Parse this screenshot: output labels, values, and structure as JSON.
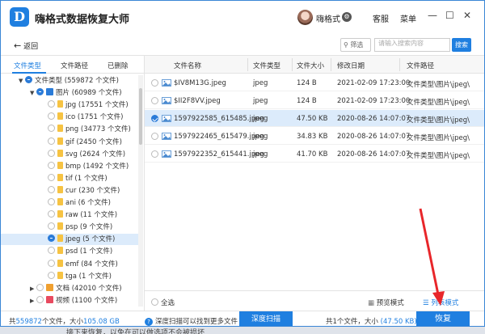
{
  "app": {
    "title": "嗨格式数据恢复大师",
    "logo_letter": "D",
    "username": "嗨格式",
    "service": "客服",
    "menu": "菜单"
  },
  "toolbar": {
    "back": "返回",
    "filter": "筛选",
    "search_placeholder": "请输入搜索内容",
    "search_btn": "搜索"
  },
  "left_tabs": [
    "文件类型",
    "文件路径",
    "已删除"
  ],
  "tree": [
    {
      "label": "文件类型 (559872 个文件)",
      "indent": 0,
      "arrow": "▼",
      "check": "part",
      "folder": "none"
    },
    {
      "label": "图片 (60989 个文件)",
      "indent": 1,
      "arrow": "▼",
      "check": "part",
      "folder": "pic"
    },
    {
      "label": "jpg (17551 个文件)",
      "indent": 2,
      "arrow": "",
      "check": "",
      "folder": "y"
    },
    {
      "label": "ico (1751 个文件)",
      "indent": 2,
      "arrow": "",
      "check": "",
      "folder": "y"
    },
    {
      "label": "png (34773 个文件)",
      "indent": 2,
      "arrow": "",
      "check": "",
      "folder": "y"
    },
    {
      "label": "gif (2450 个文件)",
      "indent": 2,
      "arrow": "",
      "check": "",
      "folder": "y"
    },
    {
      "label": "svg (2624 个文件)",
      "indent": 2,
      "arrow": "",
      "check": "",
      "folder": "y"
    },
    {
      "label": "bmp (1492 个文件)",
      "indent": 2,
      "arrow": "",
      "check": "",
      "folder": "y"
    },
    {
      "label": "tif (1 个文件)",
      "indent": 2,
      "arrow": "",
      "check": "",
      "folder": "y"
    },
    {
      "label": "cur (230 个文件)",
      "indent": 2,
      "arrow": "",
      "check": "",
      "folder": "y"
    },
    {
      "label": "ani (6 个文件)",
      "indent": 2,
      "arrow": "",
      "check": "",
      "folder": "y"
    },
    {
      "label": "raw (11 个文件)",
      "indent": 2,
      "arrow": "",
      "check": "",
      "folder": "y"
    },
    {
      "label": "psp (9 个文件)",
      "indent": 2,
      "arrow": "",
      "check": "",
      "folder": "y"
    },
    {
      "label": "jpeg (5 个文件)",
      "indent": 2,
      "arrow": "",
      "check": "part",
      "folder": "y",
      "selected": true
    },
    {
      "label": "psd (1 个文件)",
      "indent": 2,
      "arrow": "",
      "check": "",
      "folder": "y"
    },
    {
      "label": "emf (84 个文件)",
      "indent": 2,
      "arrow": "",
      "check": "",
      "folder": "y"
    },
    {
      "label": "tga (1 个文件)",
      "indent": 2,
      "arrow": "",
      "check": "",
      "folder": "y"
    },
    {
      "label": "文档 (42010 个文件)",
      "indent": 1,
      "arrow": "▶",
      "check": "",
      "folder": "doc"
    },
    {
      "label": "视频 (1100 个文件)",
      "indent": 1,
      "arrow": "▶",
      "check": "",
      "folder": "vid"
    }
  ],
  "columns": [
    "文件名称",
    "文件类型",
    "文件大小",
    "修改日期",
    "文件路径"
  ],
  "files": [
    {
      "name": "$IV8M13G.jpeg",
      "type": "jpeg",
      "size": "124 B",
      "date": "2021-02-09 17:23:00",
      "path": "文件类型\\图片\\jpeg\\",
      "checked": false
    },
    {
      "name": "$II2F8VV.jpeg",
      "type": "jpeg",
      "size": "124 B",
      "date": "2021-02-09 17:23:00",
      "path": "文件类型\\图片\\jpeg\\",
      "checked": false
    },
    {
      "name": "1597922585_615485.jpeg",
      "type": "jpeg",
      "size": "47.50 KB",
      "date": "2020-08-26 14:07:07",
      "path": "文件类型\\图片\\jpeg\\",
      "checked": true
    },
    {
      "name": "1597922465_615479.jpeg",
      "type": "jpeg",
      "size": "34.83 KB",
      "date": "2020-08-26 14:07:07",
      "path": "文件类型\\图片\\jpeg\\",
      "checked": false
    },
    {
      "name": "1597922352_615441.jpeg",
      "type": "jpeg",
      "size": "41.70 KB",
      "date": "2020-08-26 14:07:07",
      "path": "文件类型\\图片\\jpeg\\",
      "checked": false
    }
  ],
  "footer_right": {
    "select_all": "全选",
    "preview_mode": "预览模式",
    "list_mode": "列表模式"
  },
  "bottom": {
    "stat_prefix": "共",
    "stat_count": "559872",
    "stat_mid": "个文件，大小",
    "stat_size": "105.08 GB",
    "tip": "深度扫描可以找到更多文件",
    "deep_scan": "深度扫描",
    "sel_prefix": "共1个文件，大小",
    "sel_size": "(47.50 KB)",
    "recover": "恢复"
  },
  "under_text": "接下来恢复，以免在可以做选项不会被损坏",
  "colors": {
    "accent": "#1f7fe0",
    "selected_row": "#dcebfb",
    "arrow": "#e8262a"
  }
}
